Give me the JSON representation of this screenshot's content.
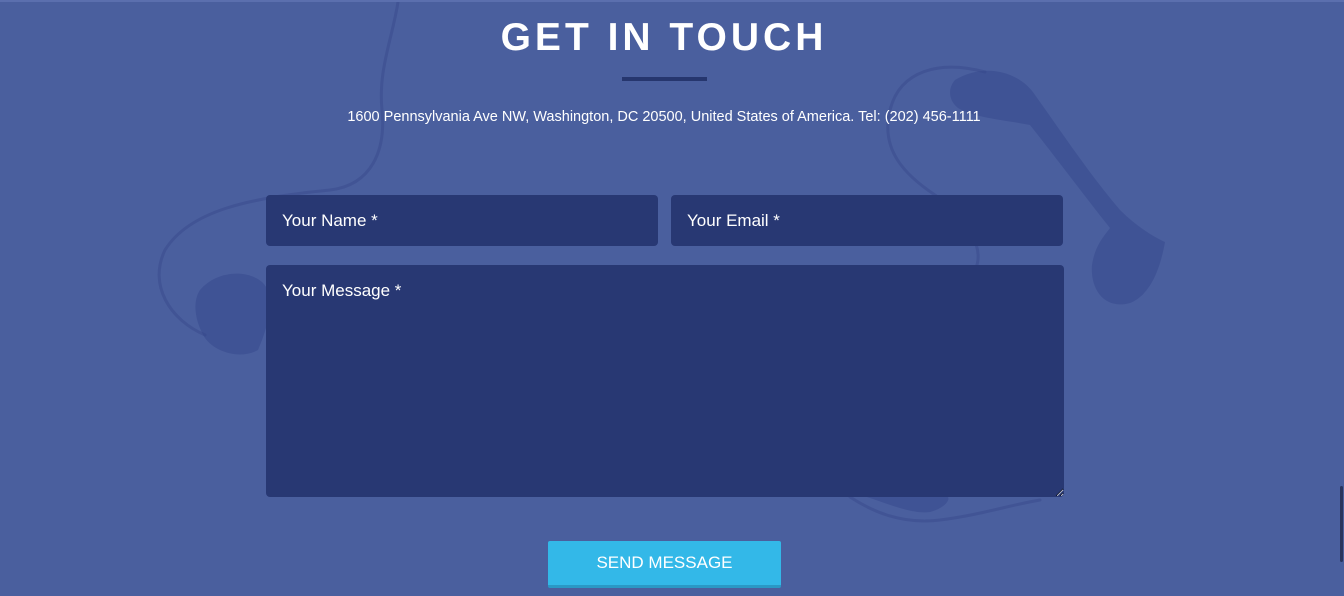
{
  "contact": {
    "title": "GET IN TOUCH",
    "address": "1600 Pennsylvania Ave NW, Washington, DC 20500, United States of America. Tel: (202) 456-1111"
  },
  "form": {
    "name_placeholder": "Your Name *",
    "email_placeholder": "Your Email *",
    "message_placeholder": "Your Message *",
    "send_label": "SEND MESSAGE"
  },
  "background": {
    "image": "telephone-handsets-icon"
  },
  "colors": {
    "background": "#4a5f9e",
    "field": "#283873",
    "accent": "#33b8e8",
    "divider": "#26366e"
  }
}
